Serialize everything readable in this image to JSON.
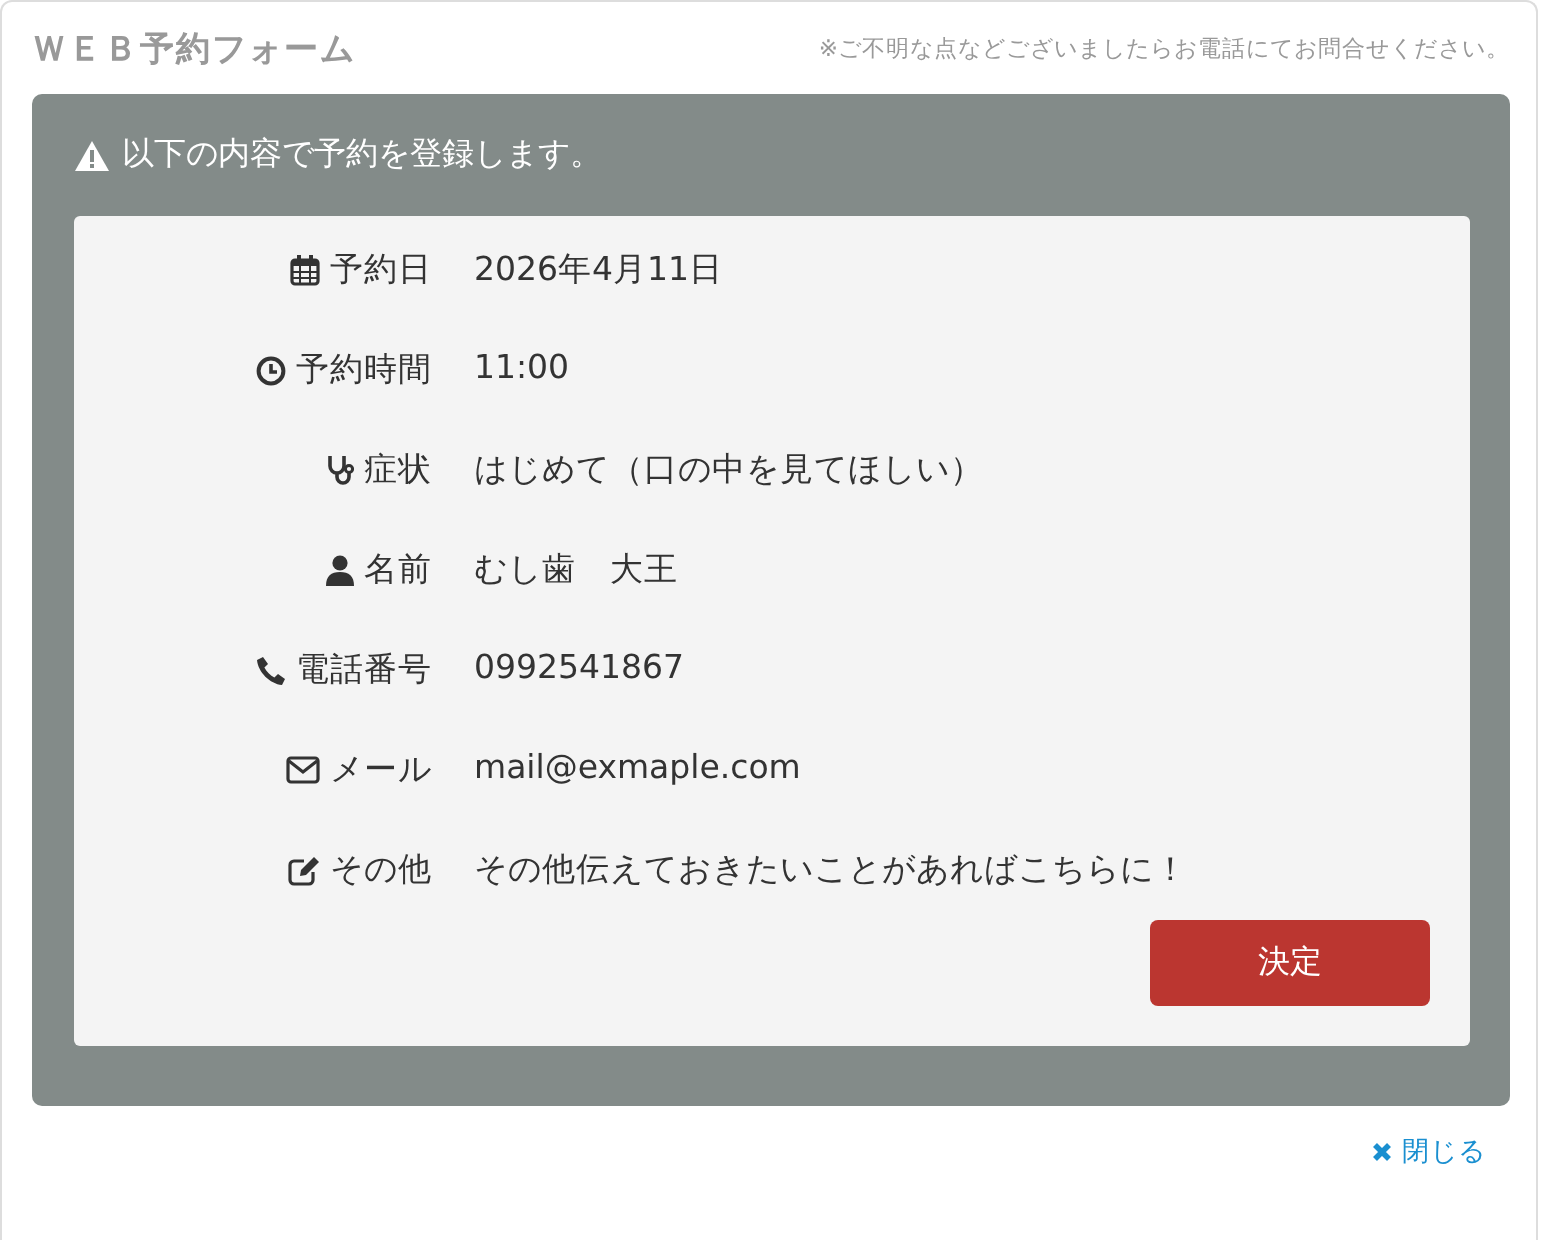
{
  "header": {
    "title": "ＷＥＢ予約フォーム",
    "notice": "※ご不明な点などございましたらお電話にてお問合せください。"
  },
  "panel": {
    "message": "以下の内容で予約を登録します。",
    "fields": [
      {
        "kind": "calendar",
        "label": "予約日",
        "value": "2026年4月11日"
      },
      {
        "kind": "clock",
        "label": "予約時間",
        "value": "11:00"
      },
      {
        "kind": "stethoscope",
        "label": "症状",
        "value": "はじめて（口の中を見てほしい）"
      },
      {
        "kind": "user",
        "label": "名前",
        "value": "むし歯　大王"
      },
      {
        "kind": "phone",
        "label": "電話番号",
        "value": "0992541867"
      },
      {
        "kind": "envelope",
        "label": "メール",
        "value": "mail@exmaple.com"
      },
      {
        "kind": "edit",
        "label": "その他",
        "value": "その他伝えておきたいことがあればこちらに！"
      }
    ],
    "submit": "決定"
  },
  "close": {
    "label": "閉じる"
  }
}
